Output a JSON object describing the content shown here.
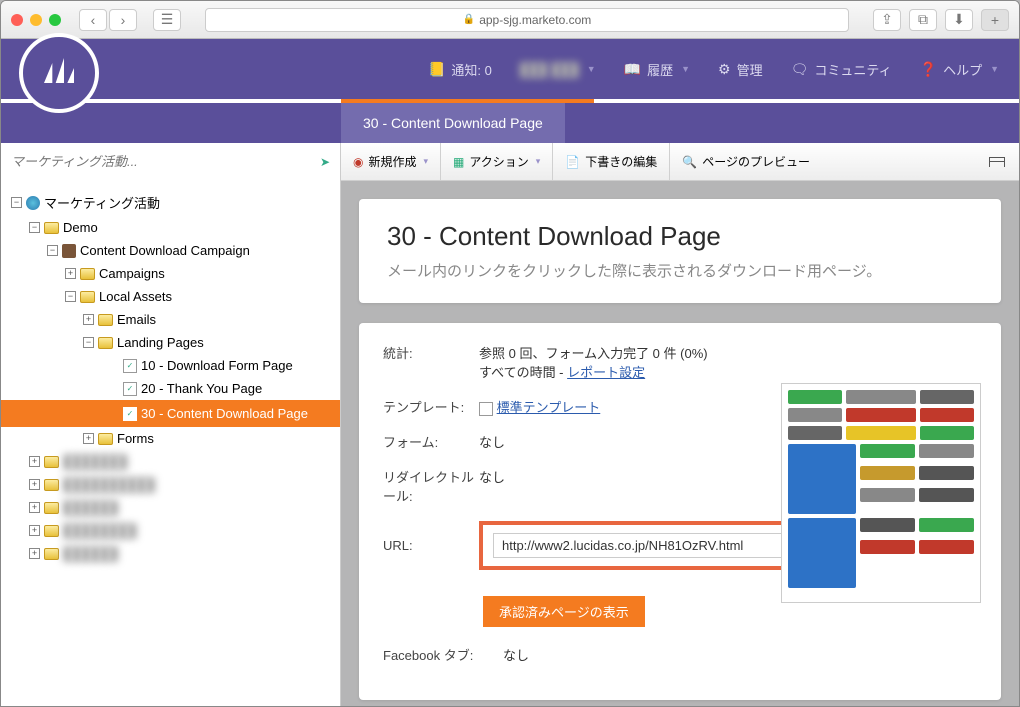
{
  "browser": {
    "url": "app-sjg.marketo.com"
  },
  "header": {
    "notify": "通知: 0",
    "user_masked": "███ ███",
    "history": "履歴",
    "admin": "管理",
    "community": "コミュニティ",
    "help": "ヘルプ"
  },
  "tab": {
    "label": "30 - Content Download Page"
  },
  "toolbar": {
    "search_placeholder": "マーケティング活動...",
    "new": "新規作成",
    "action": "アクション",
    "edit_draft": "下書きの編集",
    "preview": "ページのプレビュー"
  },
  "tree": {
    "root": "マーケティング活動",
    "demo": "Demo",
    "campaign": "Content Download Campaign",
    "campaigns": "Campaigns",
    "local": "Local Assets",
    "emails": "Emails",
    "lp": "Landing Pages",
    "p1": "10 - Download Form Page",
    "p2": "20 - Thank You Page",
    "p3": "30 - Content Download Page",
    "forms": "Forms",
    "masked1": "███████",
    "masked2": "██████████",
    "masked3": "██████",
    "masked4": "████████",
    "masked5": "██████"
  },
  "main": {
    "title": "30 - Content Download Page",
    "desc": "メール内のリンクをクリックした際に表示されるダウンロード用ページ。",
    "stats_label": "統計:",
    "stats_value": "参照 0 回、フォーム入力完了 0 件 (0%)",
    "stats_time": "すべての時間 - ",
    "report_link": "レポート設定",
    "template_label": "テンプレート:",
    "template_value": "標準テンプレート",
    "form_label": "フォーム:",
    "form_value": "なし",
    "redirect_label": "リダイレクトルール:",
    "redirect_value": "なし",
    "url_label": "URL:",
    "url_value": "http://www2.lucidas.co.jp/NH81OzRV.html",
    "approved_btn": "承認済みページの表示",
    "fb_label": "Facebook タブ:",
    "fb_value": "なし"
  }
}
